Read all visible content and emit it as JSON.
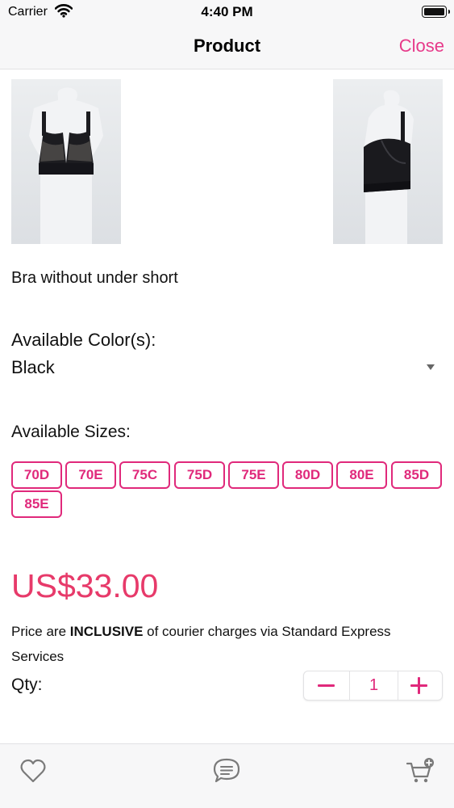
{
  "status_bar": {
    "carrier": "Carrier",
    "time": "4:40 PM"
  },
  "nav": {
    "title": "Product",
    "close_label": "Close"
  },
  "product": {
    "name": "Bra without under short",
    "colors_label": "Available Color(s):",
    "selected_color": "Black",
    "sizes_label": "Available Sizes:",
    "sizes": [
      "70D",
      "70E",
      "75C",
      "75D",
      "75E",
      "80D",
      "80E",
      "85D",
      "85E"
    ],
    "price": "US$33.00",
    "shipping_note": {
      "before": "Price are ",
      "emphasis": "INCLUSIVE",
      "after": " of courier charges via Standard Express Services"
    },
    "qty_label": "Qty:",
    "quantity": "1"
  },
  "tab_bar": {
    "icons": [
      "heart-icon",
      "chat-bubble-icon",
      "cart-add-icon"
    ]
  },
  "colors": {
    "accent": "#e0297b",
    "price": "#e73a6a",
    "close": "#e73a8a",
    "icon_gray": "#7a7a7a",
    "bar_bg": "#f7f7f8"
  }
}
